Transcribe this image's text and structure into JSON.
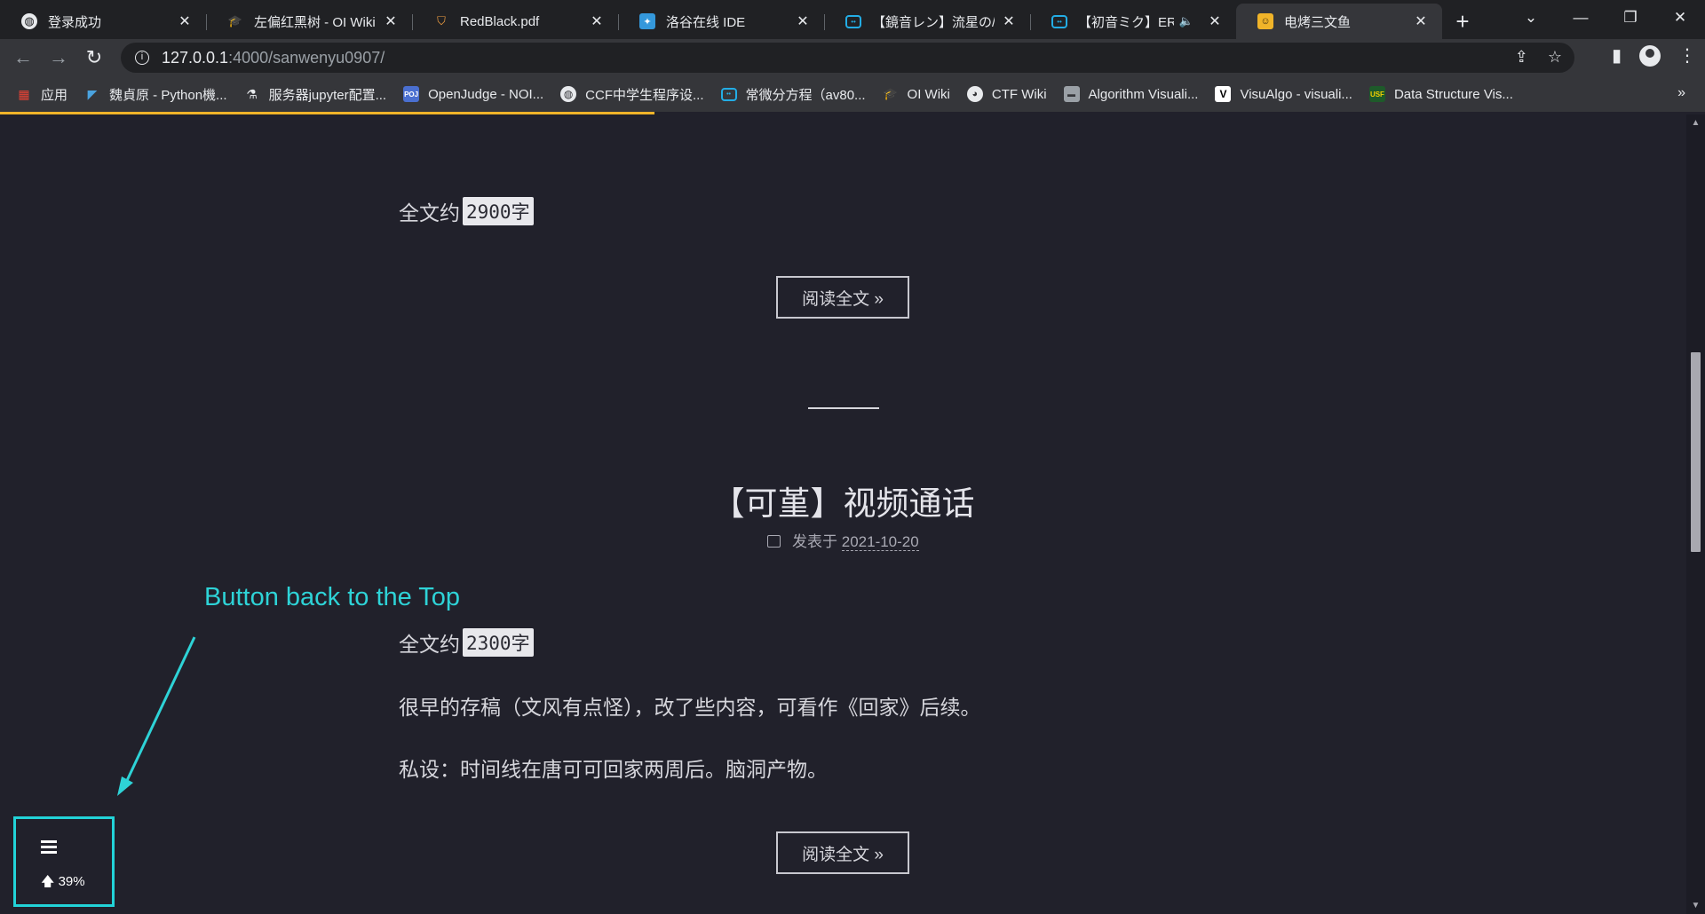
{
  "browser": {
    "tabs": [
      {
        "title": "登录成功",
        "icon": "globe-icon",
        "active": false
      },
      {
        "title": "左偏红黑树 - OI Wiki",
        "icon": "oiwiki-icon",
        "active": false
      },
      {
        "title": "RedBlack.pdf",
        "icon": "pdf-icon",
        "active": false
      },
      {
        "title": "洛谷在线 IDE",
        "icon": "luogu-icon",
        "active": false
      },
      {
        "title": "【鏡音レン】流星の/",
        "icon": "bilibili-icon",
        "active": false
      },
      {
        "title": "【初音ミク】ERR",
        "icon": "bilibili-icon",
        "active": false
      },
      {
        "title": "电烤三文鱼",
        "icon": "site-icon",
        "active": true
      }
    ],
    "address": {
      "host": "127.0.0.1",
      "path": ":4000/sanwenyu0907/"
    },
    "bookmarks": [
      {
        "label": "应用",
        "icon": "apps-grid-icon"
      },
      {
        "label": "魏貞原 - Python機...",
        "icon": "bird-icon"
      },
      {
        "label": "服务器jupyter配置...",
        "icon": "jupyter-icon"
      },
      {
        "label": "OpenJudge - NOI...",
        "icon": "poj-icon"
      },
      {
        "label": "CCF中学生程序设...",
        "icon": "globe-icon"
      },
      {
        "label": "常微分方程（av80...",
        "icon": "bilibili-icon"
      },
      {
        "label": "OI Wiki",
        "icon": "oiwiki-icon"
      },
      {
        "label": "CTF Wiki",
        "icon": "ctf-icon"
      },
      {
        "label": "Algorithm Visuali...",
        "icon": "algo-icon"
      },
      {
        "label": "VisuAlgo - visuali...",
        "icon": "visualgo-icon"
      },
      {
        "label": "Data Structure Vis...",
        "icon": "usf-icon"
      }
    ],
    "more_bookmarks": "»",
    "scroll_progress_pct": 39
  },
  "page": {
    "post1": {
      "wordcount_prefix": "全文约",
      "wordcount": "2900字",
      "read_more": "阅读全文 »"
    },
    "post2": {
      "title": "【可堇】视频通话",
      "meta_label": "发表于",
      "date": "2021-10-20",
      "wordcount_prefix": "全文约",
      "wordcount": "2300字",
      "para1": "很早的存稿（文风有点怪），改了些内容，可看作《回家》后续。",
      "para2": "私设：时间线在唐可可回家两周后。脑洞产物。",
      "read_more": "阅读全文 »"
    },
    "annotation": "Button back to the Top",
    "back_to_top": {
      "percent": "39%"
    }
  },
  "colors": {
    "accent": "#22d3d8",
    "progress": "#f0b429",
    "background": "#21212b"
  }
}
